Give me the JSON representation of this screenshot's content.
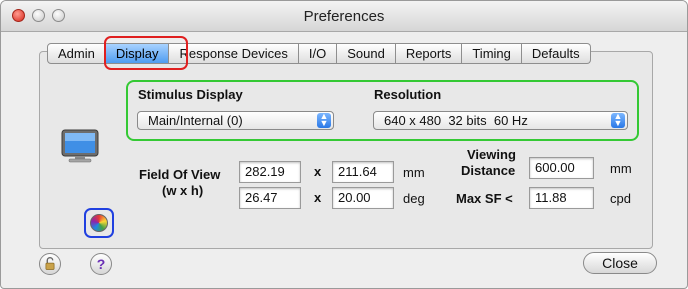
{
  "window": {
    "title": "Preferences"
  },
  "tabs": [
    {
      "label": "Admin"
    },
    {
      "label": "Display",
      "active": true
    },
    {
      "label": "Response Devices"
    },
    {
      "label": "I/O"
    },
    {
      "label": "Sound"
    },
    {
      "label": "Reports"
    },
    {
      "label": "Timing"
    },
    {
      "label": "Defaults"
    }
  ],
  "display": {
    "stimulus_label": "Stimulus Display",
    "stimulus_value": "Main/Internal (0)",
    "resolution_label": "Resolution",
    "resolution_value": "640 x 480  32 bits  60 Hz",
    "fov_label_line1": "Field Of View",
    "fov_label_line2": "(w x h)",
    "fov_w_mm": "282.19",
    "fov_h_mm": "211.64",
    "fov_w_deg": "26.47",
    "fov_h_deg": "20.00",
    "x_symbol": "x",
    "unit_mm": "mm",
    "unit_deg": "deg",
    "viewing_label_line1": "Viewing",
    "viewing_label_line2": "Distance",
    "viewing_distance": "600.00",
    "viewing_unit": "mm",
    "maxsf_label": "Max SF <",
    "maxsf_value": "11.88",
    "maxsf_unit": "cpd"
  },
  "footer": {
    "help_glyph": "?",
    "close_label": "Close"
  },
  "icons": {
    "monitor": "monitor-icon",
    "color_wheel": "color-wheel-icon",
    "lock": "lock-icon",
    "help": "help-icon"
  },
  "colors": {
    "highlight_red": "#e02020",
    "highlight_green": "#34c934",
    "highlight_blue": "#2040e0",
    "tab_active": "#4f9cf0"
  }
}
